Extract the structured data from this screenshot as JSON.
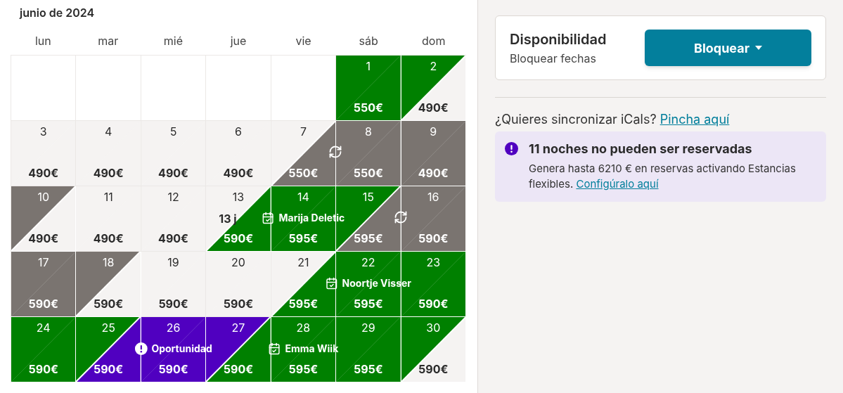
{
  "calendar": {
    "month": "junio de 2024",
    "weekdays": [
      "lun",
      "mar",
      "mié",
      "jue",
      "vie",
      "sáb",
      "dom"
    ],
    "weeks": [
      [
        {
          "kind": "blank"
        },
        {
          "kind": "blank"
        },
        {
          "kind": "blank"
        },
        {
          "kind": "blank"
        },
        {
          "kind": "blank"
        },
        {
          "kind": "day",
          "day": "1",
          "price": "550€",
          "morning": {
            "kind": "booked"
          },
          "night": {
            "kind": "booked"
          }
        },
        {
          "kind": "day",
          "day": "2",
          "price": "490€",
          "morning": {
            "kind": "booked"
          },
          "night": {
            "kind": "free"
          }
        }
      ],
      [
        {
          "kind": "day",
          "day": "3",
          "price": "490€",
          "morning": {
            "kind": "free"
          },
          "night": {
            "kind": "free"
          }
        },
        {
          "kind": "day",
          "day": "4",
          "price": "490€",
          "morning": {
            "kind": "free"
          },
          "night": {
            "kind": "free"
          }
        },
        {
          "kind": "day",
          "day": "5",
          "price": "490€",
          "morning": {
            "kind": "free"
          },
          "night": {
            "kind": "free"
          }
        },
        {
          "kind": "day",
          "day": "6",
          "price": "490€",
          "morning": {
            "kind": "free"
          },
          "night": {
            "kind": "free"
          }
        },
        {
          "kind": "day",
          "day": "7",
          "price": "550€",
          "morning": {
            "kind": "free"
          },
          "night": {
            "kind": "blocked"
          },
          "event": {
            "kind": "sync"
          }
        },
        {
          "kind": "day",
          "day": "8",
          "price": "550€",
          "morning": {
            "kind": "blocked"
          },
          "night": {
            "kind": "blocked"
          }
        },
        {
          "kind": "day",
          "day": "9",
          "price": "490€",
          "morning": {
            "kind": "blocked"
          },
          "night": {
            "kind": "blocked"
          }
        }
      ],
      [
        {
          "kind": "day",
          "day": "10",
          "price": "490€",
          "morning": {
            "kind": "blocked"
          },
          "night": {
            "kind": "free"
          }
        },
        {
          "kind": "day",
          "day": "11",
          "price": "490€",
          "morning": {
            "kind": "free"
          },
          "night": {
            "kind": "free"
          }
        },
        {
          "kind": "day",
          "day": "12",
          "price": "490€",
          "morning": {
            "kind": "free"
          },
          "night": {
            "kind": "free"
          }
        },
        {
          "kind": "day",
          "day": "13",
          "price": "590€",
          "morning": {
            "kind": "free"
          },
          "night": {
            "kind": "booked"
          },
          "note": "13 j"
        },
        {
          "kind": "day",
          "day": "14",
          "price": "595€",
          "morning": {
            "kind": "booked"
          },
          "night": {
            "kind": "booked"
          },
          "event": {
            "kind": "booking",
            "label": "Marija Deletic"
          }
        },
        {
          "kind": "day",
          "day": "15",
          "price": "595€",
          "morning": {
            "kind": "booked"
          },
          "night": {
            "kind": "blocked"
          },
          "event": {
            "kind": "sync"
          }
        },
        {
          "kind": "day",
          "day": "16",
          "price": "590€",
          "morning": {
            "kind": "blocked"
          },
          "night": {
            "kind": "blocked"
          }
        }
      ],
      [
        {
          "kind": "day",
          "day": "17",
          "price": "590€",
          "morning": {
            "kind": "blocked"
          },
          "night": {
            "kind": "blocked"
          }
        },
        {
          "kind": "day",
          "day": "18",
          "price": "590€",
          "morning": {
            "kind": "blocked"
          },
          "night": {
            "kind": "free"
          }
        },
        {
          "kind": "day",
          "day": "19",
          "price": "590€",
          "morning": {
            "kind": "free"
          },
          "night": {
            "kind": "free"
          }
        },
        {
          "kind": "day",
          "day": "20",
          "price": "590€",
          "morning": {
            "kind": "free"
          },
          "night": {
            "kind": "free"
          }
        },
        {
          "kind": "day",
          "day": "21",
          "price": "595€",
          "morning": {
            "kind": "free"
          },
          "night": {
            "kind": "booked"
          }
        },
        {
          "kind": "day",
          "day": "22",
          "price": "595€",
          "morning": {
            "kind": "booked"
          },
          "night": {
            "kind": "booked"
          },
          "event": {
            "kind": "booking",
            "label": "Noortje Visser"
          }
        },
        {
          "kind": "day",
          "day": "23",
          "price": "590€",
          "morning": {
            "kind": "booked"
          },
          "night": {
            "kind": "booked"
          }
        }
      ],
      [
        {
          "kind": "day",
          "day": "24",
          "price": "590€",
          "morning": {
            "kind": "booked"
          },
          "night": {
            "kind": "booked"
          }
        },
        {
          "kind": "day",
          "day": "25",
          "price": "590€",
          "morning": {
            "kind": "booked"
          },
          "night": {
            "kind": "opportunity"
          }
        },
        {
          "kind": "day",
          "day": "26",
          "price": "590€",
          "morning": {
            "kind": "opportunity"
          },
          "night": {
            "kind": "opportunity"
          },
          "event": {
            "kind": "opportunity",
            "label": "Oportunidad"
          }
        },
        {
          "kind": "day",
          "day": "27",
          "price": "590€",
          "morning": {
            "kind": "opportunity"
          },
          "night": {
            "kind": "booked"
          }
        },
        {
          "kind": "day",
          "day": "28",
          "price": "595€",
          "morning": {
            "kind": "booked"
          },
          "night": {
            "kind": "booked"
          },
          "event": {
            "kind": "booking",
            "label": "Emma Wiik"
          }
        },
        {
          "kind": "day",
          "day": "29",
          "price": "595€",
          "morning": {
            "kind": "booked"
          },
          "night": {
            "kind": "booked"
          }
        },
        {
          "kind": "day",
          "day": "30",
          "price": "590€",
          "morning": {
            "kind": "booked"
          },
          "night": {
            "kind": "free"
          }
        }
      ]
    ]
  },
  "availability": {
    "title": "Disponibilidad",
    "subtitle": "Bloquear fechas",
    "button": "Bloquear"
  },
  "sync": {
    "text": "¿Quieres sincronizar iCals?",
    "link": "Pincha aquí"
  },
  "alert": {
    "title": "11 noches no pueden ser reservadas",
    "body": "Genera hasta 6210 € en reservas activando Estancias flexibles.",
    "link": "Configúralo aquí"
  }
}
